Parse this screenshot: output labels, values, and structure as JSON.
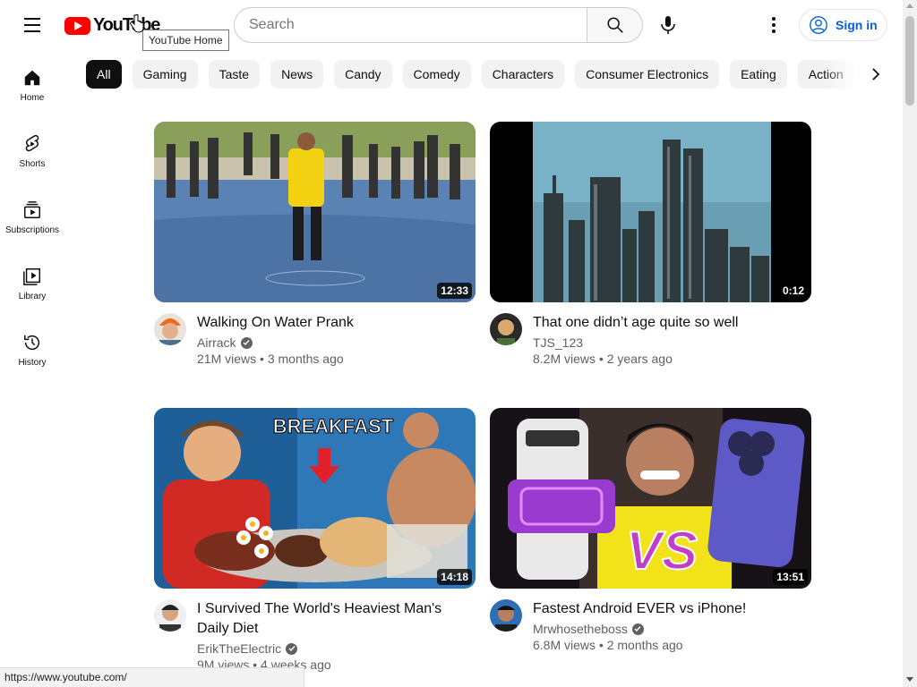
{
  "header": {
    "logo_text": "YouTube",
    "logo_tooltip": "YouTube Home",
    "search_placeholder": "Search",
    "sign_in": "Sign in"
  },
  "sidebar": {
    "items": [
      {
        "label": "Home",
        "icon": "home-icon"
      },
      {
        "label": "Shorts",
        "icon": "shorts-icon"
      },
      {
        "label": "Subscriptions",
        "icon": "subscriptions-icon"
      },
      {
        "label": "Library",
        "icon": "library-icon"
      },
      {
        "label": "History",
        "icon": "history-icon"
      }
    ]
  },
  "chips": [
    "All",
    "Gaming",
    "Taste",
    "News",
    "Candy",
    "Comedy",
    "Characters",
    "Consumer Electronics",
    "Eating",
    "Action"
  ],
  "videos": [
    {
      "title": "Walking On Water Prank",
      "channel": "Airrack",
      "verified": true,
      "views": "21M views",
      "age": "3 months ago",
      "duration": "12:33"
    },
    {
      "title": "That one didn’t age quite so well",
      "channel": "TJS_123",
      "verified": false,
      "views": "8.2M views",
      "age": "2 years ago",
      "duration": "0:12"
    },
    {
      "title": "I Survived The World's Heaviest Man's Daily Diet",
      "channel": "ErikTheElectric",
      "verified": true,
      "views": "9M views",
      "age": "4 weeks ago",
      "duration": "14:18",
      "thumb_text": "BREAKFAST"
    },
    {
      "title": "Fastest Android EVER vs iPhone!",
      "channel": "Mrwhosetheboss",
      "verified": true,
      "views": "6.8M views",
      "age": "2 months ago",
      "duration": "13:51",
      "thumb_text": "VS"
    }
  ],
  "status_url": "https://www.youtube.com/",
  "colors": {
    "brand": "#ff0000",
    "link": "#065fd4",
    "text": "#0f0f0f",
    "secondary": "#606060",
    "chip_bg": "#f2f2f2"
  }
}
